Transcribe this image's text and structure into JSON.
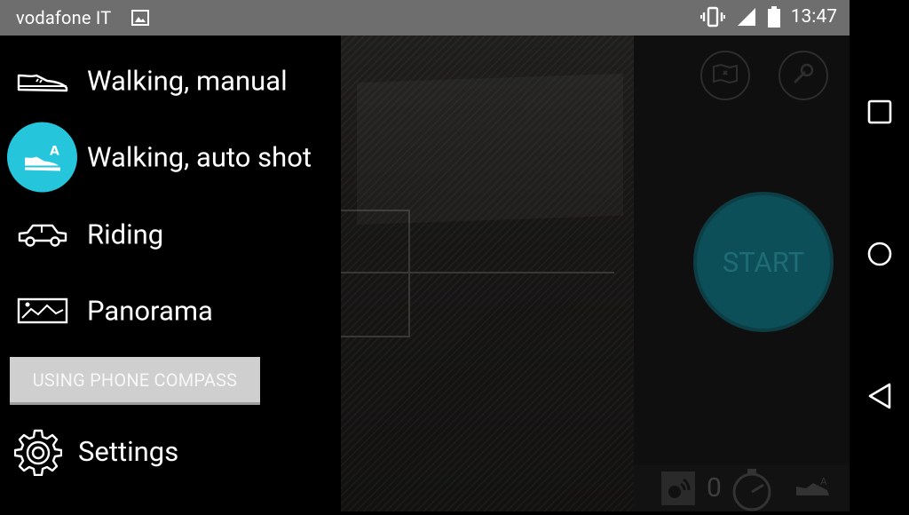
{
  "status_bar": {
    "carrier": "vodafone IT",
    "time": "13:47"
  },
  "modes": [
    {
      "label": "Walking, manual",
      "icon": "walking-shoe-icon",
      "active": false
    },
    {
      "label": "Walking, auto shot",
      "icon": "walking-shoe-auto-icon",
      "active": true
    },
    {
      "label": "Riding",
      "icon": "car-icon",
      "active": false
    },
    {
      "label": "Panorama",
      "icon": "panorama-icon",
      "active": false
    }
  ],
  "compass_button": {
    "label": "USING PHONE COMPASS"
  },
  "settings": {
    "label": "Settings"
  },
  "start_button": {
    "label": "START"
  },
  "bottom_bar": {
    "count": "0"
  },
  "colors": {
    "accent": "#25c6db",
    "status_bar": "#6e6e6e",
    "start_dim": "#0c4f58"
  }
}
